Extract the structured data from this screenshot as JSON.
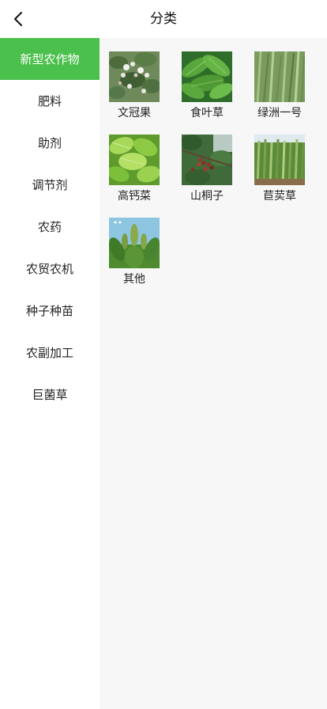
{
  "header": {
    "title": "分类",
    "back_icon": "chevron-left-icon"
  },
  "sidebar": {
    "active_index": 0,
    "accent_color": "#4cc04c",
    "items": [
      {
        "label": "新型农作物"
      },
      {
        "label": "肥料"
      },
      {
        "label": "助剂"
      },
      {
        "label": "调节剂"
      },
      {
        "label": "农药"
      },
      {
        "label": "农贸农机"
      },
      {
        "label": "种子种苗"
      },
      {
        "label": "农副加工"
      },
      {
        "label": "巨菌草"
      }
    ]
  },
  "categories": [
    {
      "label": "文冠果"
    },
    {
      "label": "食叶草"
    },
    {
      "label": "绿洲一号"
    },
    {
      "label": "高钙菜"
    },
    {
      "label": "山桐子"
    },
    {
      "label": "苣荬草"
    },
    {
      "label": "其他"
    }
  ]
}
